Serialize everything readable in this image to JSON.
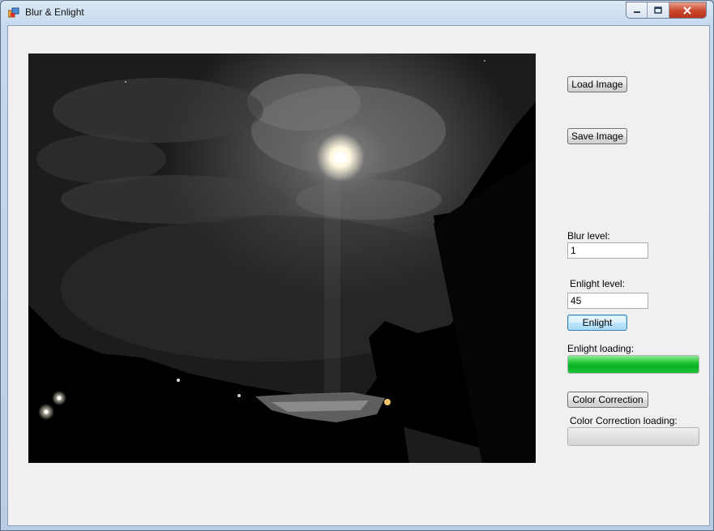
{
  "window": {
    "title": "Blur & Enlight",
    "controls": {
      "minimize_icon": "minimize-icon",
      "maximize_icon": "maximize-icon",
      "close_icon": "close-icon"
    }
  },
  "buttons": {
    "load_image": "Load Image",
    "save_image": "Save Image",
    "enlight": "Enlight",
    "color_correction": "Color Correction"
  },
  "blur": {
    "label": "Blur level:",
    "value": "1"
  },
  "enlight": {
    "label": "Enlight level:",
    "value": "45"
  },
  "enlight_loading": {
    "label": "Enlight loading:",
    "progress": 1.0
  },
  "color_correction_loading": {
    "label": "Color Correction loading:",
    "progress": 0.0
  },
  "colors": {
    "progress_green": "#06b025",
    "focus_border": "#3c7fb1"
  }
}
